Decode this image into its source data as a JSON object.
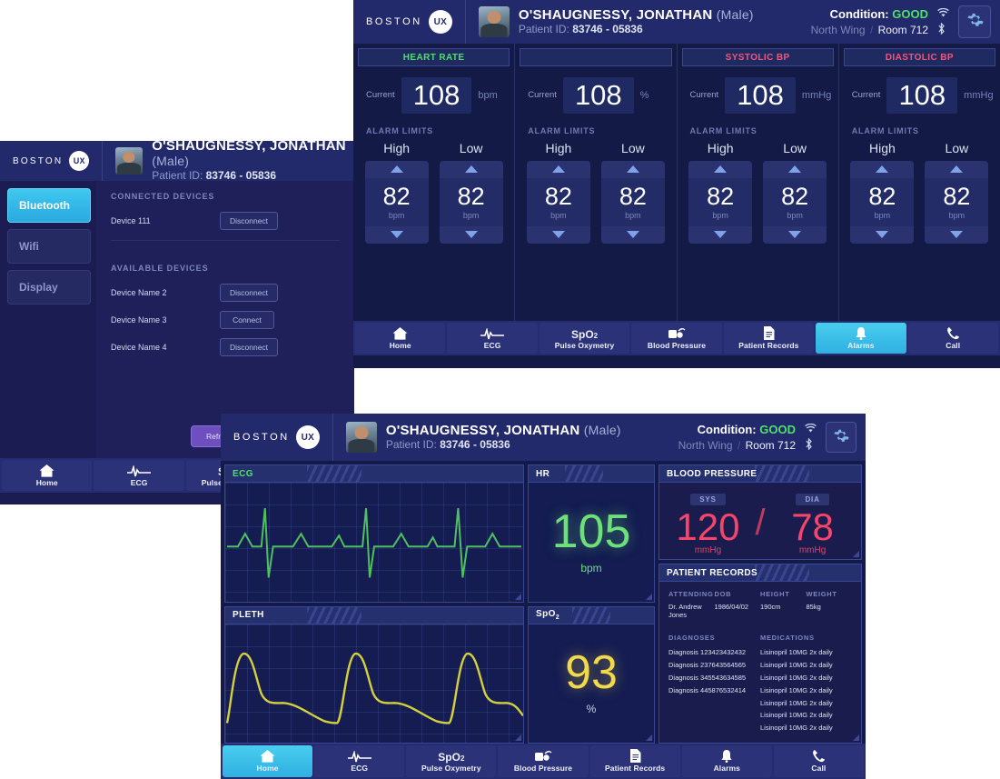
{
  "brand": {
    "name": "BOSTON",
    "pill": "UX"
  },
  "patient": {
    "name": "O'SHAUGNESSY, JONATHAN",
    "sex": "(Male)",
    "id_label": "Patient ID:",
    "id_value": "83746 - 05836"
  },
  "status": {
    "condition_label": "Condition:",
    "condition_value": "GOOD",
    "wing": "North Wing",
    "separator": "/",
    "room": "Room 712",
    "wifi_icon": "wifi-icon",
    "bluetooth_icon": "bluetooth-icon",
    "gear_icon": "gear-icon"
  },
  "nav": {
    "items": [
      {
        "label": "Home",
        "icon": "home-icon"
      },
      {
        "label": "ECG",
        "icon": "ecg-waveform-icon"
      },
      {
        "label": "Pulse Oxymetry",
        "icon": "spo2-icon"
      },
      {
        "label": "Blood Pressure",
        "icon": "blood-pressure-cuff-icon"
      },
      {
        "label": "Patient Records",
        "icon": "document-icon"
      },
      {
        "label": "Alarms",
        "icon": "bell-icon"
      },
      {
        "label": "Call",
        "icon": "phone-icon"
      }
    ],
    "dashboard_active": "Home",
    "alarms_active": "Alarms"
  },
  "settings": {
    "sidebar": [
      {
        "label": "Bluetooth",
        "active": true
      },
      {
        "label": "Wifi",
        "active": false
      },
      {
        "label": "Display",
        "active": false
      }
    ],
    "connected_title": "CONNECTED DEVICES",
    "connected": [
      {
        "name": "Device 111",
        "action": "Disconnect"
      }
    ],
    "available_title": "AVAILABLE DEVICES",
    "available": [
      {
        "name": "Device Name 2",
        "action": "Disconnect"
      },
      {
        "name": "Device Name 3",
        "action": "Connect"
      },
      {
        "name": "Device Name 4",
        "action": "Disconnect"
      }
    ],
    "refresh_label": "Refresh Devices"
  },
  "alarms": {
    "limits_label": "ALARM LIMITS",
    "current_label": "Current",
    "high_label": "High",
    "low_label": "Low",
    "columns": [
      {
        "title": "HEART RATE",
        "title_color": "#4fe06a",
        "current": "108",
        "unit": "bpm",
        "high": "82",
        "high_unit": "bpm",
        "low": "82",
        "low_unit": "bpm"
      },
      {
        "title": "",
        "title_color": "#ffffff",
        "current": "108",
        "unit": "%",
        "high": "82",
        "high_unit": "bpm",
        "low": "82",
        "low_unit": "bpm"
      },
      {
        "title": "SYSTOLIC BP",
        "title_color": "#f0577f",
        "current": "108",
        "unit": "mmHg",
        "high": "82",
        "high_unit": "bpm",
        "low": "82",
        "low_unit": "bpm"
      },
      {
        "title": "DIASTOLIC BP",
        "title_color": "#f0577f",
        "current": "108",
        "unit": "mmHg",
        "high": "82",
        "high_unit": "bpm",
        "low": "82",
        "low_unit": "bpm"
      }
    ]
  },
  "dashboard": {
    "ecg_title": "ECG",
    "pleth_title": "PLETH",
    "hr_title": "HR",
    "hr_value": "105",
    "hr_unit": "bpm",
    "spo2_title": "SpO",
    "spo2_sub": "2",
    "spo2_value": "93",
    "spo2_unit": "%",
    "bp_title": "BLOOD PRESSURE",
    "bp_sys_badge": "SYS",
    "bp_sys_value": "120",
    "bp_sys_unit": "mmHg",
    "bp_slash": "/",
    "bp_dia_badge": "DIA",
    "bp_dia_value": "78",
    "bp_dia_unit": "mmHg",
    "records_title": "PATIENT RECORDS",
    "fields": [
      {
        "label": "ATTENDING",
        "value": "Dr. Andrew Jones"
      },
      {
        "label": "DOB",
        "value": "1986/04/02"
      },
      {
        "label": "HEIGHT",
        "value": "190cm"
      },
      {
        "label": "WEIGHT",
        "value": "85kg"
      }
    ],
    "diagnoses_title": "DIAGNOSES",
    "diagnoses": [
      "Diagnosis 123423432432",
      "Diagnosis 237643564565",
      "Diagnosis 345543634585",
      "Diagnosis 445876532414"
    ],
    "medications_title": "MEDICATIONS",
    "medications": [
      "Lisinopril 10MG 2x daily",
      "Lisinopril 10MG 2x daily",
      "Lisinopril 10MG 2x daily",
      "Lisinopril 10MG 2x daily",
      "Lisinopril 10MG 2x daily",
      "Lisinopril 10MG 2x daily",
      "Lisinopril 10MG 2x daily"
    ]
  },
  "colors": {
    "accent_cyan": "#3fc8ef",
    "good_green": "#4fe06a",
    "ecg_green": "#4fc05e",
    "pleth_yellow": "#d4cf3c",
    "bp_red": "#f5456b",
    "purple_button": "#6d4fbd"
  }
}
